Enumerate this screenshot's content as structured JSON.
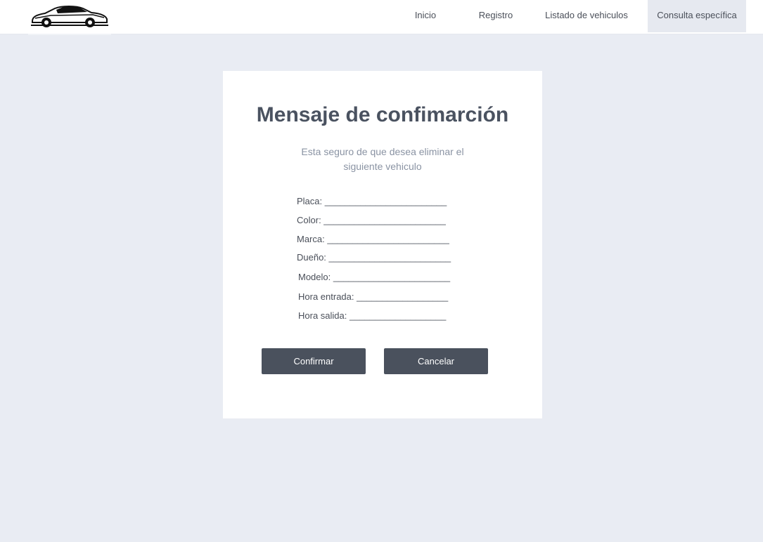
{
  "nav": {
    "items": [
      {
        "label": "Inicio"
      },
      {
        "label": "Registro"
      },
      {
        "label": "Listado de vehiculos"
      },
      {
        "label": "Consulta específica"
      }
    ],
    "active": "Consulta específica"
  },
  "dialog": {
    "title": "Mensaje de confimarción",
    "message": "Esta seguro de que desea eliminar el siguiente vehiculo",
    "fields": [
      {
        "label": "Placa: ________________________"
      },
      {
        "label": "Color: ________________________"
      },
      {
        "label": "Marca: ________________________"
      },
      {
        "label": "Dueño: ________________________"
      },
      {
        "label": "Modelo: _______________________"
      },
      {
        "label": "Hora entrada: __________________"
      },
      {
        "label": "Hora salida: ___________________"
      }
    ],
    "confirm_label": "Confirmar",
    "cancel_label": "Cancelar"
  },
  "colors": {
    "background": "#e9ecf3",
    "button": "#4a515d",
    "title": "#4a5260",
    "message": "#8a93a3"
  }
}
